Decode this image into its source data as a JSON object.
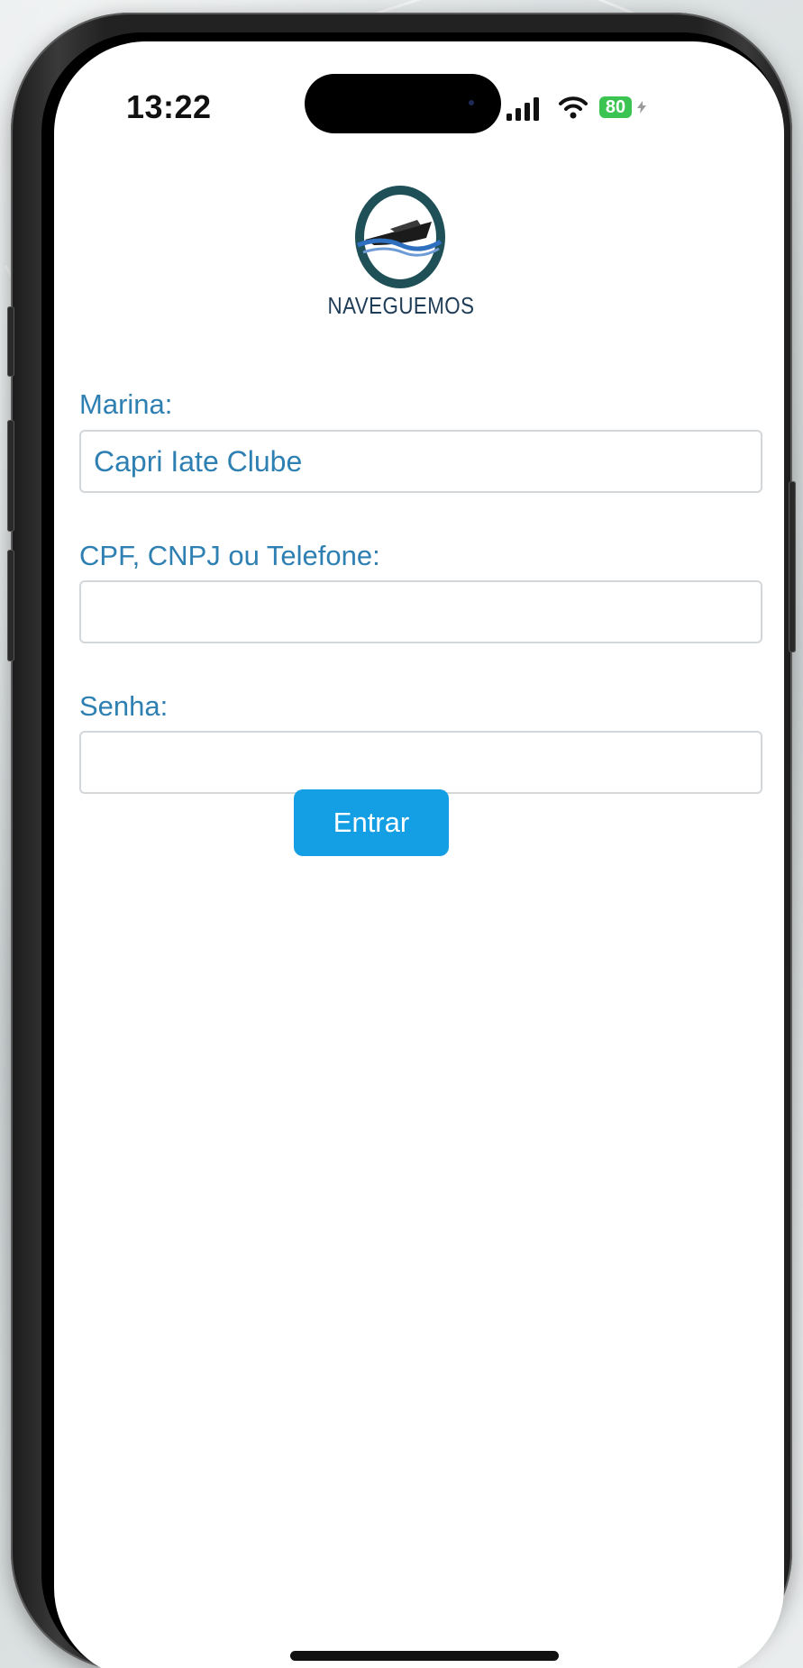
{
  "status_bar": {
    "time": "13:22",
    "battery": "80",
    "icons": [
      "signal-bars-icon",
      "wifi-icon",
      "battery-charging-icon"
    ]
  },
  "brand": {
    "name": "NAVEGUEMOS",
    "logo_icon": "boat-emblem-icon",
    "colors": {
      "ring": "#1f4f57",
      "hull": "#1b1b1b",
      "wave": "#2f6fc0",
      "text": "#1f3d57"
    }
  },
  "form": {
    "marina_label": "Marina:",
    "marina_value": "Capri Iate Clube",
    "login_label": "CPF, CNPJ ou Telefone:",
    "login_value": "",
    "password_label": "Senha:",
    "password_value": "",
    "submit_label": "Entrar"
  },
  "theme": {
    "label_color": "#2e7fb2",
    "button_color": "#149ee3",
    "field_border": "#d3d7da"
  }
}
